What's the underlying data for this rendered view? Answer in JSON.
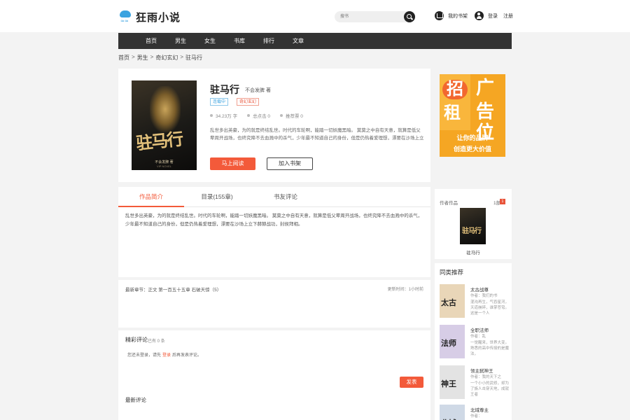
{
  "header": {
    "logo_text": "狂雨小说",
    "logo_sub": "≈≈",
    "search_placeholder": "搜书",
    "shelf_label": "我的书架",
    "login_label": "登录",
    "register_label": "注册"
  },
  "nav": {
    "items": [
      {
        "label": "首页"
      },
      {
        "label": "男生"
      },
      {
        "label": "女生"
      },
      {
        "label": "书库"
      },
      {
        "label": "排行"
      },
      {
        "label": "文章"
      }
    ]
  },
  "breadcrumb": {
    "items": [
      "首页",
      "男生",
      "奇幻玄幻",
      "驻马行"
    ],
    "separator": ">"
  },
  "book": {
    "title": "驻马行",
    "author": "不会发脾 著",
    "status_tag": "连载中",
    "genre_tag": "奇幻玄幻",
    "words": "34.23万 字",
    "collections": "总点击 0",
    "recommends": "推荐票 0",
    "intro_short": "乱世多出英豪，为的就是终结乱世。时代的车轮啊，能踏一切妖魔黑暗。 莫莫之中自有天意，就算是低父辈周开战场，也终究降不去血溅中的杀气，少年最不知道自己的身份，但是仍热着爱理想，漂要在沙场上立下赫赫战功，封侯拜相。",
    "cover_title": "驻马行",
    "cover_author": "不会发脾 著",
    "cover_sub": "VIP NOVEL",
    "read_button": "马上阅读",
    "shelf_button": "加入书架"
  },
  "ad": {
    "char1": "招",
    "char2": "租",
    "char3": "广",
    "char4": "告位",
    "line1": "让你的品牌",
    "line2": "创造更大价值"
  },
  "tabs": {
    "items": [
      {
        "label": "作品简介"
      },
      {
        "label": "目录(155章)"
      },
      {
        "label": "书友评论"
      }
    ],
    "active": 0
  },
  "intro_full": "乱世多出英豪，为的就是终结乱世。时代的车轮啊，能踏一切妖魔黑暗。 莫莫之中自有天意，就算是低父辈周开战场，也终究降不去血溅中的杀气，少年最不知道自己的身份，但是仍热着爱理想，漂要在沙场上立下赫赫战功，封侯拜相。",
  "latest": {
    "chapter": "最新章节：正文 第一百五十五章 石破天惊（5）",
    "updated": "更新时间：1小时前"
  },
  "comments": {
    "title": "精彩评论",
    "count": "已有 0 条",
    "tip_prefix": "您还未登录，请先",
    "tip_login": "登录",
    "tip_suffix": "后再发表评论。",
    "send_button": "发表",
    "latest_title": "最新评论"
  },
  "author_works": {
    "label": "作者作品",
    "count": "1部",
    "badge": "1",
    "cover_title": "驻马行",
    "book_name": "驻马行"
  },
  "recommend": {
    "title": "同类推荐",
    "items": [
      {
        "name": "太古战尊",
        "author": "作者：我们的书",
        "desc": "混沌再生，气吞星河，天道崩碎，谁掌苍穹。这是一个人",
        "cover_text": "太古",
        "cover_color": "#e9d6b8"
      },
      {
        "name": "全职法师",
        "author": "作者：乱",
        "desc": "一觉醒来，世界大变。熟悉的高中传授的是魔法，",
        "cover_text": "法师",
        "cover_color": "#d7cde6"
      },
      {
        "name": "领主弑神王",
        "author": "作者：我的天下之",
        "desc": "一个小小的武修，却为了族人击穿天地，成就王者",
        "cover_text": "神王",
        "cover_color": "#e3e3e3"
      },
      {
        "name": "北域尊主",
        "author": "作者：",
        "desc": "",
        "cover_text": "北域",
        "cover_color": "#cfd9e6"
      }
    ]
  },
  "colors": {
    "accent": "#f35a3a",
    "nav_bg": "#333333",
    "brand_blue": "#3ba3e0",
    "ad_orange": "#f5a623"
  }
}
